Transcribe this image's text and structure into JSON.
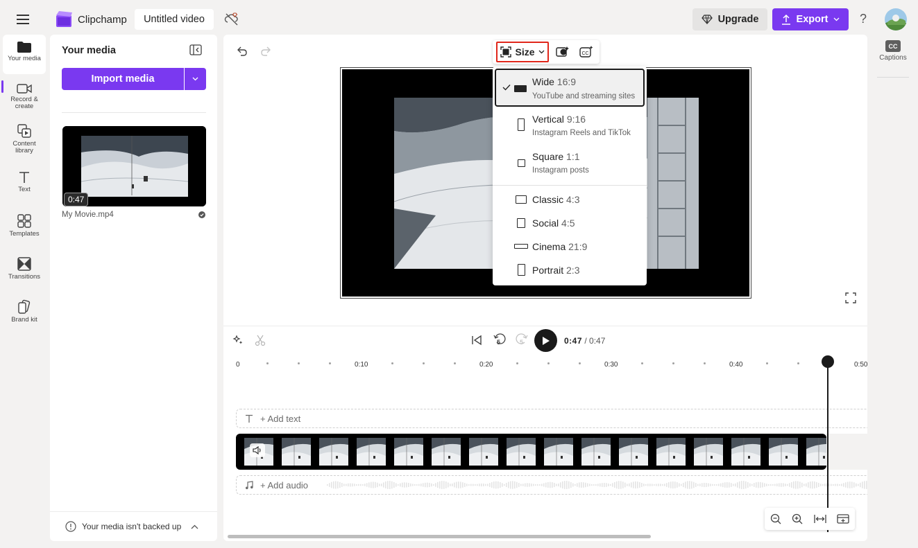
{
  "topbar": {
    "app_name": "Clipchamp",
    "project_title": "Untitled video",
    "upgrade_label": "Upgrade",
    "export_label": "Export",
    "help_label": "?"
  },
  "nav": {
    "items": [
      {
        "label": "Your media",
        "icon": "folder-icon"
      },
      {
        "label": "Record & create",
        "icon": "camera-icon"
      },
      {
        "label": "Content library",
        "icon": "library-icon"
      },
      {
        "label": "Text",
        "icon": "text-icon"
      },
      {
        "label": "Templates",
        "icon": "templates-icon"
      },
      {
        "label": "Transitions",
        "icon": "transitions-icon"
      },
      {
        "label": "Brand kit",
        "icon": "brand-kit-icon"
      }
    ]
  },
  "media": {
    "title": "Your media",
    "import_label": "Import media",
    "items": [
      {
        "name": "My Movie.mp4",
        "duration": "0:47"
      }
    ],
    "backup_notice": "Your media isn't backed up"
  },
  "toolbar": {
    "size_label": "Size"
  },
  "size_menu": {
    "options": [
      {
        "name": "Wide",
        "ratio": "16:9",
        "desc": "YouTube and streaming sites",
        "selected": true
      },
      {
        "name": "Vertical",
        "ratio": "9:16",
        "desc": "Instagram Reels and TikTok"
      },
      {
        "name": "Square",
        "ratio": "1:1",
        "desc": "Instagram posts"
      },
      {
        "name": "Classic",
        "ratio": "4:3"
      },
      {
        "name": "Social",
        "ratio": "4:5"
      },
      {
        "name": "Cinema",
        "ratio": "21:9"
      },
      {
        "name": "Portrait",
        "ratio": "2:3"
      }
    ]
  },
  "playback": {
    "current_time": "0:47",
    "total_time": "/ 0:47",
    "skip_back": "5",
    "skip_forward": "5"
  },
  "timeline": {
    "ticks": [
      "0",
      "0:10",
      "0:20",
      "0:30",
      "0:40",
      "0:50"
    ],
    "add_text_label": "+ Add text",
    "add_audio_label": "+ Add audio",
    "filmstrip_frames": 16
  },
  "captions": {
    "badge": "CC",
    "label": "Captions"
  },
  "colors": {
    "accent": "#7a39f0",
    "highlight_border": "#e0261a"
  }
}
